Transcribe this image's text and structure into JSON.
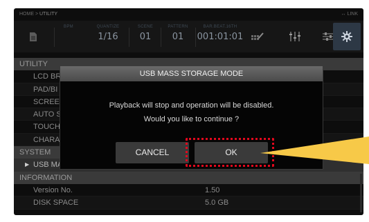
{
  "breadcrumb": {
    "home": "HOME",
    "sep": ">",
    "current": "UTILITY",
    "link": "LINK"
  },
  "toolbar": {
    "bpm": {
      "label": "BPM",
      "value": ""
    },
    "quantize": {
      "label": "QUANTIZE",
      "value": "1/16"
    },
    "scene": {
      "label": "SCENE",
      "value": "01"
    },
    "pattern": {
      "label": "PATTERN",
      "value": "01"
    },
    "position": {
      "label": "BAR.BEAT.16TH",
      "value": "001:01:01"
    }
  },
  "list": {
    "utility_header": "UTILITY",
    "utility_items": [
      "LCD BR",
      "PAD/BI",
      "SCREEN",
      "AUTO S",
      "TOUCH",
      "CHARA"
    ],
    "system_header": "SYSTEM",
    "selected_item": "USB MASS STORAGE MODE",
    "information_header": "INFORMATION",
    "info_rows": [
      {
        "label": "Version No.",
        "value": "1.50"
      },
      {
        "label": "DISK SPACE",
        "value": "5.0 GB"
      }
    ]
  },
  "dialog": {
    "title": "USB MASS STORAGE MODE",
    "line1": "Playback will stop and operation will be disabled.",
    "line2": "Would you like to continue ?",
    "cancel_label": "CANCEL",
    "ok_label": "OK"
  },
  "colors": {
    "highlight": "#e3081d",
    "callout": "#f7c948",
    "panel": "#0d0d0d"
  }
}
